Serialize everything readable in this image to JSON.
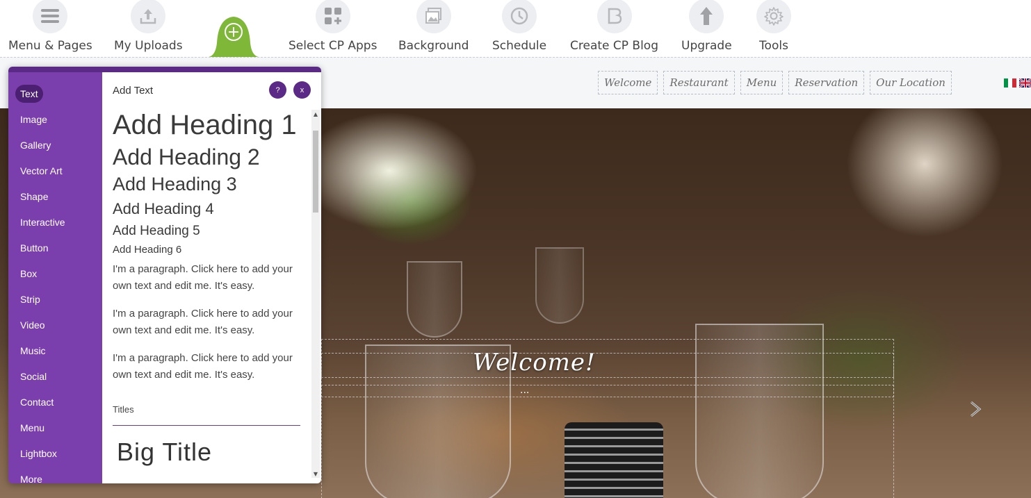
{
  "toolbar": {
    "items": [
      {
        "label": "Menu & Pages",
        "icon": "hamburger-icon"
      },
      {
        "label": "My Uploads",
        "icon": "upload-icon"
      },
      {
        "label": "Select CP Apps",
        "icon": "apps-grid-icon"
      },
      {
        "label": "Background",
        "icon": "image-icon"
      },
      {
        "label": "Schedule",
        "icon": "clock-icon"
      },
      {
        "label": "Create CP Blog",
        "icon": "blog-icon"
      },
      {
        "label": "Upgrade",
        "icon": "arrow-up-icon"
      },
      {
        "label": "Tools",
        "icon": "gear-icon"
      }
    ],
    "add_button": {
      "icon": "plus-icon",
      "color": "#7fb739"
    }
  },
  "site": {
    "nav": [
      "Welcome",
      "Restaurant",
      "Menu",
      "Reservation",
      "Our Location"
    ],
    "flags": [
      "italy-flag-icon",
      "uk-flag-icon"
    ],
    "hero_title": "Welcome!",
    "hero_subtitle": "...",
    "next_icon": "chevron-right-icon"
  },
  "panel": {
    "title": "Add Text",
    "help_label": "?",
    "close_label": "x",
    "accent": "#7b3fad",
    "categories": [
      "Text",
      "Image",
      "Gallery",
      "Vector Art",
      "Shape",
      "Interactive",
      "Button",
      "Box",
      "Strip",
      "Video",
      "Music",
      "Social",
      "Contact",
      "Menu",
      "Lightbox",
      "More"
    ],
    "active_category": "Text",
    "headings": [
      "Add Heading 1",
      "Add Heading 2",
      "Add Heading 3",
      "Add Heading 4",
      "Add Heading 5",
      "Add Heading 6"
    ],
    "paragraphs": [
      "I'm a paragraph. Click here to add your own text and edit me. It's easy.",
      "I'm a paragraph. Click here to add your own text and edit me. It's easy.",
      "I'm a paragraph. Click here to add your own text and edit me. It's easy."
    ],
    "titles_section_label": "Titles",
    "big_title": "Big Title"
  }
}
